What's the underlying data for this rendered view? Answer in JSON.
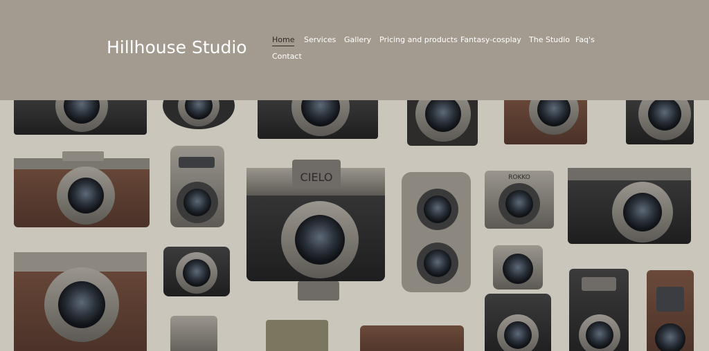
{
  "header": {
    "site_title": "Hillhouse Studio",
    "nav": [
      {
        "label": "Home",
        "active": true
      },
      {
        "label": "Services",
        "active": false
      },
      {
        "label": "Gallery",
        "active": false
      },
      {
        "label": "Pricing and products",
        "active": false
      },
      {
        "label": "Fantasy-cosplay",
        "active": false
      },
      {
        "label": "The Studio",
        "active": false
      },
      {
        "label": "Faq's",
        "active": false
      },
      {
        "label": "Contact",
        "active": false
      }
    ]
  },
  "hero": {
    "image_subject": "vintage-cameras-collage",
    "camera_plate_texts": [
      "CIELO",
      "ROKKO"
    ]
  },
  "colors": {
    "header_bg": "#a39b90",
    "nav_text": "#ffffff",
    "nav_active": "#2c2a27",
    "hero_bg": "#cbc6bc"
  }
}
